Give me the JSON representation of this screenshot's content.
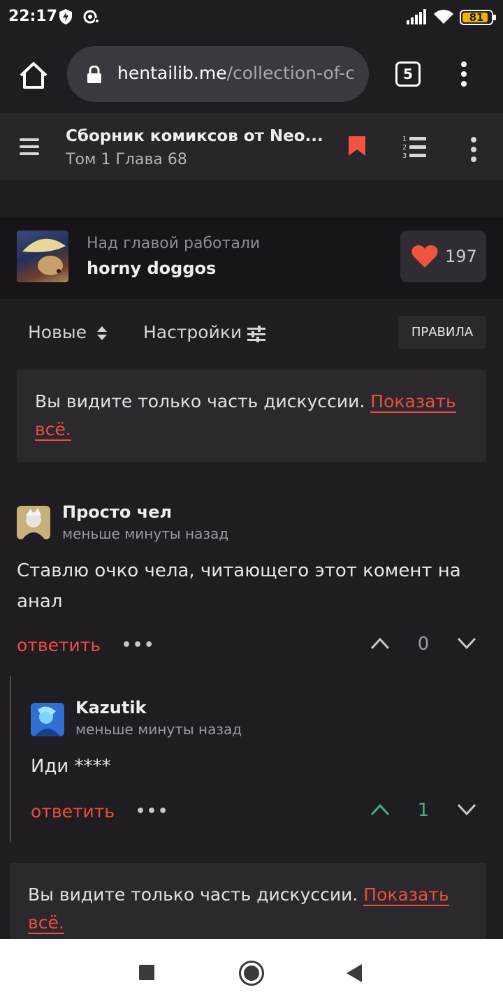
{
  "status_bar": {
    "time": "22:17",
    "battery": "81"
  },
  "browser": {
    "url_host": "hentailib.me",
    "url_path": "/collection-of-c",
    "tab_count": "5"
  },
  "reader_header": {
    "title": "Сборник комиксов от Neo...",
    "subtitle": "Том 1 Глава 68"
  },
  "team": {
    "caption": "Над главой работали",
    "name": "horny doggos",
    "likes": "197"
  },
  "toolbar": {
    "sort_label": "Новые",
    "settings_label": "Настройки",
    "rules_label": "ПРАВИЛА"
  },
  "notice": {
    "text": "Вы видите только часть дискуссии.",
    "link": "Показать всё."
  },
  "comments": [
    {
      "author": "Просто чел",
      "time": "меньше минуты назад",
      "text": "Ставлю очко чела, читающего этот комент на анал",
      "reply_label": "ответить",
      "more": "•••",
      "score": "0"
    },
    {
      "author": "Kazutik",
      "time": "меньше минуты назад",
      "text": "Иди ****",
      "reply_label": "ответить",
      "more": "•••",
      "score": "1"
    }
  ],
  "colors": {
    "accent": "#ef4c3c",
    "upvote": "#3fb27f",
    "background": "#1f1d22"
  }
}
